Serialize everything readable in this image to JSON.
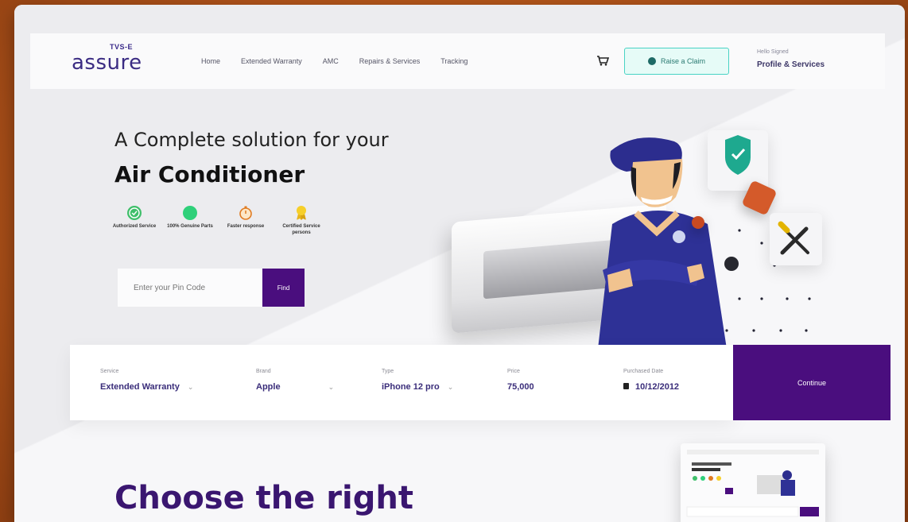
{
  "brand": {
    "logo_top": "TVS-E",
    "logo_word": "assure"
  },
  "nav": {
    "items": [
      "Home",
      "Extended Warranty",
      "AMC",
      "Repairs & Services",
      "Tracking"
    ],
    "claim_label": "Raise a Claim",
    "hello": "Hello Signed",
    "profile": "Profile & Services"
  },
  "hero": {
    "line1": "A Complete solution for your",
    "line2": "Air Conditioner",
    "features": [
      {
        "label": "Authorized Service",
        "icon": "check-circle-icon"
      },
      {
        "label": "100% Genuine Parts",
        "icon": "genuine-badge-icon"
      },
      {
        "label": "Faster response",
        "icon": "stopwatch-icon"
      },
      {
        "label": "Certified Service persons",
        "icon": "award-ribbon-icon"
      }
    ],
    "pin_placeholder": "Enter your Pin Code",
    "find_label": "Find"
  },
  "service_bar": {
    "fields": [
      {
        "label": "Service",
        "value": "Extended Warranty"
      },
      {
        "label": "Brand",
        "value": "Apple"
      },
      {
        "label": "Type",
        "value": "iPhone 12 pro"
      },
      {
        "label": "Price",
        "value": "75,000"
      },
      {
        "label": "Purchased Date",
        "value": "10/12/2012"
      }
    ],
    "continue_label": "Continue"
  },
  "section": {
    "heading": "Choose the right"
  },
  "colors": {
    "primary": "#4a0e7e",
    "brand_text": "#3b2c83",
    "accent_teal": "#49d3c4",
    "background": "#b0531a"
  }
}
